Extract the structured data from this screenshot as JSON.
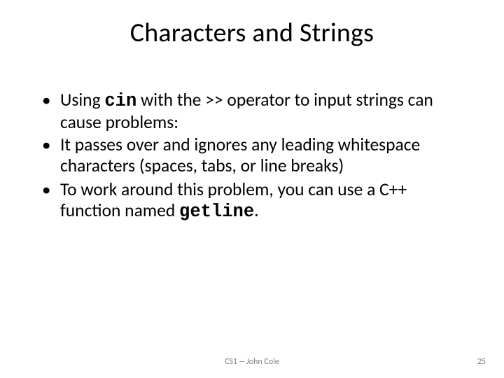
{
  "title": "Characters and Strings",
  "bullets": [
    {
      "pre": "Using ",
      "code": "cin",
      "post": " with the >> operator to input strings can cause problems:"
    },
    {
      "pre": "It passes over and ignores any leading whitespace characters (spaces, tabs, or line breaks)",
      "code": "",
      "post": ""
    },
    {
      "pre": "To work around this problem, you can use a C++ function named ",
      "code": "getline",
      "post": "."
    }
  ],
  "footer": {
    "center": "CS1 -- John Cole",
    "page": "25"
  }
}
